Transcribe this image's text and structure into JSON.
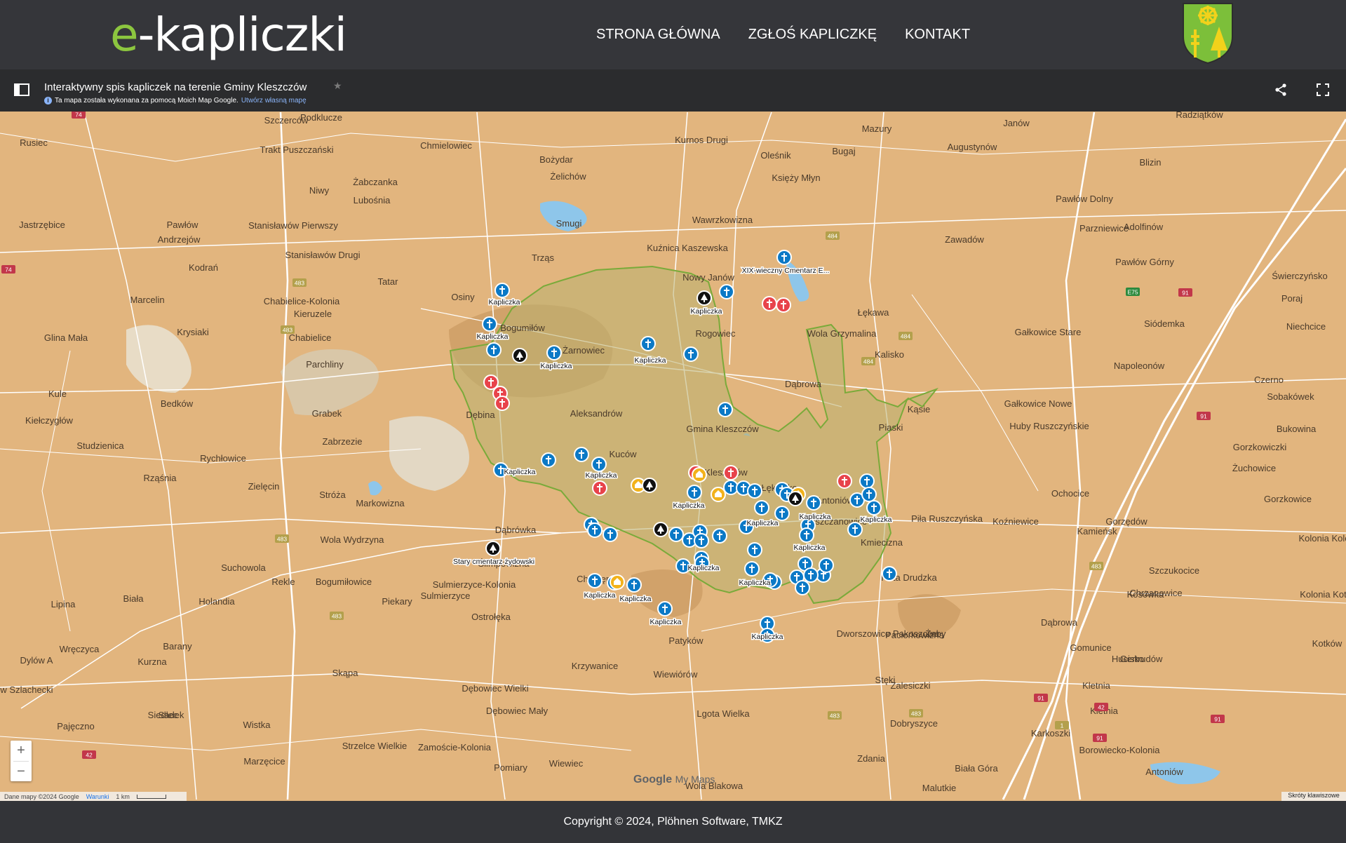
{
  "site": {
    "logo_prefix": "e",
    "logo_rest": "-kapliczki",
    "nav": [
      "STRONA GŁÓWNA",
      "ZGŁOŚ KAPLICZKĘ",
      "KONTAKT"
    ],
    "crest_colors": {
      "field": "#7cbf3a",
      "gold": "#f2d21b",
      "outline": "#2d2d2d"
    }
  },
  "mymaps": {
    "title": "Interaktywny spis kapliczek na terenie Gminy Kleszczów",
    "subtitle": "Ta mapa została wykonana za pomocą Moich Map Google.",
    "subtitle_link": "Utwórz własną mapę"
  },
  "map": {
    "colors": {
      "land": "#e2b57e",
      "area": "#b9b06f",
      "area_stroke": "#7aaa3a",
      "water": "#8ec6ea",
      "road": "#ffffff",
      "marker_blue": "#0b79c6",
      "marker_red": "#e8434b",
      "marker_yellow": "#f2b21b",
      "marker_black": "#111111"
    },
    "labels": [
      {
        "text": "Szczerców"
      },
      {
        "text": "Podklucze"
      },
      {
        "text": "Rusiec"
      },
      {
        "text": "Chmielowiec"
      },
      {
        "text": "Kurnos Drugi"
      },
      {
        "text": "Mazury"
      },
      {
        "text": "Janów"
      },
      {
        "text": "Radziątków"
      },
      {
        "text": "Trakt Puszczański"
      },
      {
        "text": "Bożydar"
      },
      {
        "text": "Oleśnik"
      },
      {
        "text": "Bugaj"
      },
      {
        "text": "Augustynów"
      },
      {
        "text": "Blizin"
      },
      {
        "text": "Niwy"
      },
      {
        "text": "Żabczanka"
      },
      {
        "text": "Żelichów"
      },
      {
        "text": "Księży Młyn"
      },
      {
        "text": "Lubośnia"
      },
      {
        "text": "Jastrzębice"
      },
      {
        "text": "Pawłów"
      },
      {
        "text": "Stanisławów Pierwszy"
      },
      {
        "text": "Smugi"
      },
      {
        "text": "Wawrzkowizna"
      },
      {
        "text": "Pawłów Dolny"
      },
      {
        "text": "Parzniewice"
      },
      {
        "text": "Adolfinów"
      },
      {
        "text": "Andrzejów"
      },
      {
        "text": "Zawadów"
      },
      {
        "text": "Kodrań"
      },
      {
        "text": "Stanisławów Drugi"
      },
      {
        "text": "Trząs"
      },
      {
        "text": "Kuźnica Kaszewska"
      },
      {
        "text": "Pawłów Górny"
      },
      {
        "text": "Świerczyńsko"
      },
      {
        "text": "Tatar"
      },
      {
        "text": "Nowy Janów"
      },
      {
        "text": "Marcelin"
      },
      {
        "text": "Chabielice-Kolonia"
      },
      {
        "text": "Osiny"
      },
      {
        "text": "Poraj"
      },
      {
        "text": "Kieruzele"
      },
      {
        "text": "Łękawa"
      },
      {
        "text": "Niechcice"
      },
      {
        "text": "Krysiaki"
      },
      {
        "text": "Bogumiłów"
      },
      {
        "text": "Siódemka"
      },
      {
        "text": "Glina Mała"
      },
      {
        "text": "Chabielice"
      },
      {
        "text": "Rogowiec"
      },
      {
        "text": "Gałkowice Stare"
      },
      {
        "text": "Parchliny"
      },
      {
        "text": "Żarnowiec"
      },
      {
        "text": "Wola Grzymalina"
      },
      {
        "text": "Kalisko"
      },
      {
        "text": "Napoleonów"
      },
      {
        "text": "Czerno"
      },
      {
        "text": "Dąbrowa"
      },
      {
        "text": "Kule"
      },
      {
        "text": "Dębina"
      },
      {
        "text": "Bedków"
      },
      {
        "text": "Grabek"
      },
      {
        "text": "Aleksandrów"
      },
      {
        "text": "Kąsie"
      },
      {
        "text": "Gałkowice Nowe"
      },
      {
        "text": "Sobakówek"
      },
      {
        "text": "Kiełczygłów"
      },
      {
        "text": "Huby Ruszczyńskie"
      },
      {
        "text": "Bukowina"
      },
      {
        "text": "Piaski"
      },
      {
        "text": "Studzienica"
      },
      {
        "text": "Zabrzezie"
      },
      {
        "text": "Gmina Kleszczów"
      },
      {
        "text": "Gorzkowiczki"
      },
      {
        "text": "Rychłowice"
      },
      {
        "text": "Kuców"
      },
      {
        "text": "Żuchowice"
      },
      {
        "text": "Rząśnia"
      },
      {
        "text": "Kleszczów"
      },
      {
        "text": "Zielęcin"
      },
      {
        "text": "Stróża"
      },
      {
        "text": "Ochocice"
      },
      {
        "text": "Gorzkowice"
      },
      {
        "text": "Łękińsko"
      },
      {
        "text": "Markowizna"
      },
      {
        "text": "Antoniówka"
      },
      {
        "text": "Piła Ruszczyńska"
      },
      {
        "text": "Koźniewice"
      },
      {
        "text": "Gorzędów"
      },
      {
        "text": "Kamieńsk"
      },
      {
        "text": "Dąbrówka"
      },
      {
        "text": "Wola Wydrzyna"
      },
      {
        "text": "Łuszczanowice"
      },
      {
        "text": "Kolonia Kolo"
      },
      {
        "text": "Suchowola"
      },
      {
        "text": "Ślimpowizna"
      },
      {
        "text": "Kmiecizna"
      },
      {
        "text": "Rekle"
      },
      {
        "text": "Bogumiłowice"
      },
      {
        "text": "Huta Drudzka"
      },
      {
        "text": "Sulmierzyce-Kolonia"
      },
      {
        "text": "Szczukocice"
      },
      {
        "text": "Biała"
      },
      {
        "text": "Chorzępów"
      },
      {
        "text": "Sulmierzyce"
      },
      {
        "text": "Piekary"
      },
      {
        "text": "Holandia"
      },
      {
        "text": "Chrzanowice"
      },
      {
        "text": "Kolonia Kotków"
      },
      {
        "text": "Lipina"
      },
      {
        "text": "Kosówka"
      },
      {
        "text": "Ostrołęka"
      },
      {
        "text": "Dąbrowa"
      },
      {
        "text": "Paciorkowizna"
      },
      {
        "text": "Wręczyca"
      },
      {
        "text": "Barany"
      },
      {
        "text": "Dworszowice Pakoszowe"
      },
      {
        "text": "Patyków"
      },
      {
        "text": "Żaby"
      },
      {
        "text": "Gomunice"
      },
      {
        "text": "Kurzna"
      },
      {
        "text": "Hucisko"
      },
      {
        "text": "Gertrudów"
      },
      {
        "text": "Kotków"
      },
      {
        "text": "Dylów A"
      },
      {
        "text": "Krzywanice"
      },
      {
        "text": "Skąpa"
      },
      {
        "text": "Wiewiórów"
      },
      {
        "text": "Stęki"
      },
      {
        "text": "Dylów Szlachecki"
      },
      {
        "text": "Dębowiec Wielki"
      },
      {
        "text": "Zalesiczki"
      },
      {
        "text": "Kletnia"
      },
      {
        "text": "Dębowiec Mały"
      },
      {
        "text": "Sadek"
      },
      {
        "text": "Lgota Wielka"
      },
      {
        "text": "Kletnia"
      },
      {
        "text": "Pajęczno"
      },
      {
        "text": "Siedlec"
      },
      {
        "text": "Wistka"
      },
      {
        "text": "Dobryszyce"
      },
      {
        "text": "Karkoszki"
      },
      {
        "text": "Borowiecko-Kolonia"
      },
      {
        "text": "Strzelce Wielkie"
      },
      {
        "text": "Zamoście-Kolonia"
      },
      {
        "text": "Marzęcice"
      },
      {
        "text": "Wiewiec"
      },
      {
        "text": "Zdania"
      },
      {
        "text": "Pomiary"
      },
      {
        "text": "Biała Góra"
      },
      {
        "text": "Wola Blakowa"
      },
      {
        "text": "Antoniów"
      },
      {
        "text": "Malutkie"
      }
    ],
    "road_numbers": [
      "74",
      "74",
      "483",
      "484",
      "484",
      "484",
      "483",
      "483",
      "483",
      "483",
      "483",
      "483",
      "91",
      "91",
      "91",
      "91",
      "91",
      "E75",
      "42",
      "42",
      "1"
    ],
    "marker_labels": [
      "Kapliczka",
      "Kapliczka",
      "Kapliczka",
      "Kapliczka",
      "XIX-wieczny Cmentarz E...",
      "Kapliczka",
      "Kapliczka",
      "Kapliczka",
      "Kapliczka",
      "Kapliczka",
      "Kapliczka",
      "Kapliczka",
      "Kapliczka",
      "Kapliczka",
      "Kapliczka",
      "Kapliczka",
      "Kapliczka",
      "Kapliczka",
      "Kapliczka",
      "Stary cmentarz żydowski"
    ],
    "zoom_in": "+",
    "zoom_out": "−",
    "attribution": "Dane mapy ©2024 Google",
    "terms": "Warunki",
    "scale": "1 km",
    "shortcuts": "Skróty klawiszowe",
    "google_brand": "Google",
    "mymaps_brand": "My Maps"
  },
  "footer": {
    "copyright": "Copyright © 2024, Plöhnen Software, TMKZ"
  }
}
